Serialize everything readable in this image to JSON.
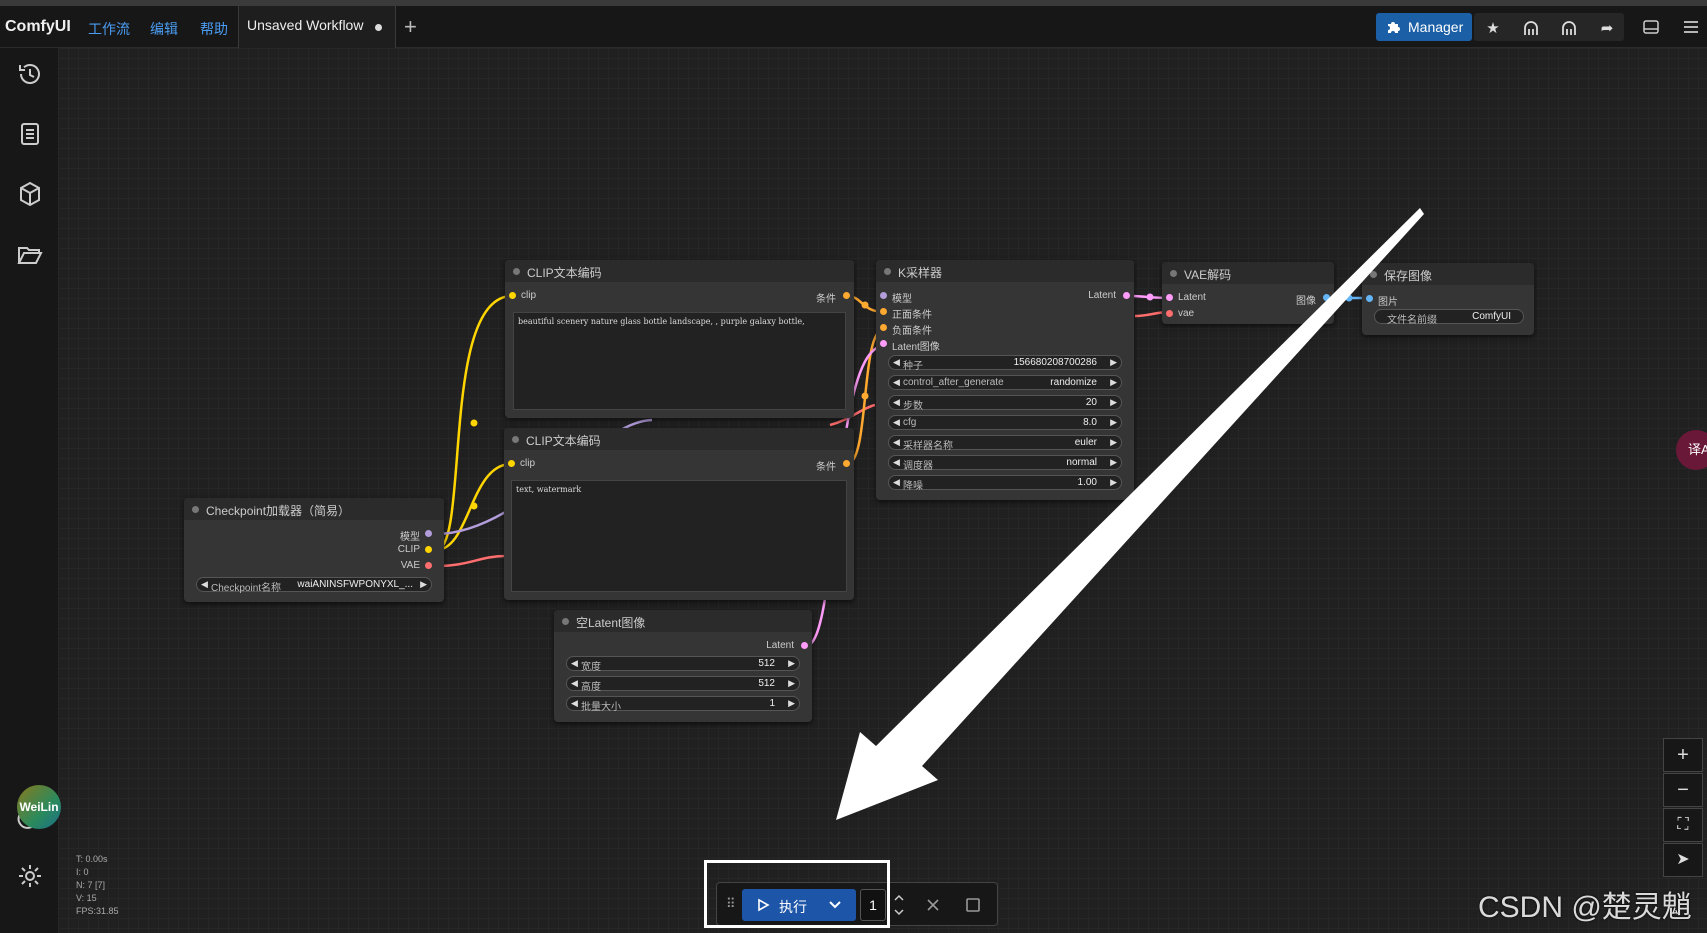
{
  "app": {
    "logo": "ComfyUI",
    "menus": [
      "工作流",
      "编辑",
      "帮助"
    ],
    "tab_title": "Unsaved Workflow",
    "manager_label": "Manager"
  },
  "colors": {
    "accent": "#1d56a8",
    "menu_link": "#4a9cf2",
    "clip_wire": "#ffd500",
    "model_wire": "#b39ddb",
    "vae_wire": "#ff6e6e",
    "cond_wire": "#ffa931",
    "latent_wire": "#ff9cf9",
    "image_wire": "#64b5f6"
  },
  "sidebar_icons": [
    "history-icon",
    "document-list-icon",
    "cube-icon",
    "folder-open-icon"
  ],
  "nodes": {
    "clip1": {
      "title": "CLIP文本编码",
      "input": "clip",
      "output": "条件",
      "text": "beautiful scenery nature glass bottle landscape, , purple galaxy bottle,"
    },
    "clip2": {
      "title": "CLIP文本编码",
      "input": "clip",
      "output": "条件",
      "text": "text, watermark"
    },
    "checkpoint": {
      "title": "Checkpoint加载器（简易）",
      "outputs": [
        "模型",
        "CLIP",
        "VAE"
      ],
      "widget_label": "Checkpoint名称",
      "widget_value": "waiANINSFWPONYXL_..."
    },
    "ksampler": {
      "title": "K采样器",
      "inputs": [
        "模型",
        "正面条件",
        "负面条件",
        "Latent图像"
      ],
      "output": "Latent",
      "widgets": [
        {
          "label": "种子",
          "value": "156680208700286"
        },
        {
          "label": "control_after_generate",
          "value": "randomize"
        },
        {
          "label": "步数",
          "value": "20"
        },
        {
          "label": "cfg",
          "value": "8.0"
        },
        {
          "label": "采样器名称",
          "value": "euler"
        },
        {
          "label": "调度器",
          "value": "normal"
        },
        {
          "label": "降噪",
          "value": "1.00"
        }
      ]
    },
    "vae": {
      "title": "VAE解码",
      "inputs": [
        "Latent",
        "vae"
      ],
      "output": "图像"
    },
    "save": {
      "title": "保存图像",
      "input": "图片",
      "widget_label": "文件名前缀",
      "widget_value": "ComfyUI"
    },
    "latent": {
      "title": "空Latent图像",
      "output": "Latent",
      "widgets": [
        {
          "label": "宽度",
          "value": "512"
        },
        {
          "label": "高度",
          "value": "512"
        },
        {
          "label": "批量大小",
          "value": "1"
        }
      ]
    }
  },
  "runbar": {
    "run_label": "执行",
    "batch_count": "1"
  },
  "stats": [
    "T: 0.00s",
    "I: 0",
    "N: 7 [7]",
    "V: 15",
    "FPS:31.85"
  ],
  "avatar_label": "WeiLin",
  "side_badge": "译A",
  "watermark": "CSDN @楚灵魈"
}
